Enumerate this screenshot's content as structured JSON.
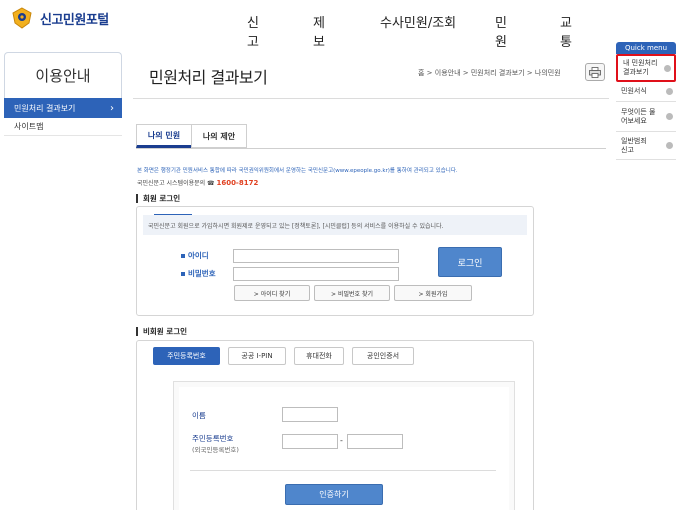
{
  "header": {
    "logo_text": "신고민원포털",
    "nav": [
      "신고",
      "제보",
      "수사민원/조회",
      "민원",
      "교통"
    ]
  },
  "sidebar": {
    "title": "이용안내",
    "items": [
      {
        "label": "민원처리 결과보기",
        "active": true
      },
      {
        "label": "사이트맵",
        "active": false
      }
    ]
  },
  "page": {
    "title": "민원처리 결과보기",
    "breadcrumb": "홈 > 이용안내 > 민원처리 결과보기 > 나의민원"
  },
  "quick_menu": {
    "title": "Quick menu",
    "items": [
      "내 민원처리 결과보기",
      "민원서식",
      "무엇이든 물어보세요",
      "일반범죄 신고"
    ]
  },
  "tabs": [
    "나의 민원",
    "나의 제안"
  ],
  "notice": "본 화면은 행정기관 민원서비스 통합에 따라 국민권익위원회에서 운영하는 국민신문고(www.epeople.go.kr)를 통하여 관리되고 있습니다.",
  "phone_label": "국민신문고 시스템이용문의 ☎",
  "phone_number": "1600-8172",
  "member": {
    "heading": "회원 로그인",
    "message": "국민신문고 회원으로 가입하시면 회원제로 운영되고 있는 [정책토론], [시민클럽] 등의 서비스를 이용하실 수 있습니다.",
    "id_label": "아이디",
    "pw_label": "비밀번호",
    "login_button": "로그인",
    "find_id": "> 아이디 찾기",
    "find_pw": "> 비밀번호 찾기",
    "join": "> 회원가입"
  },
  "nonmember": {
    "heading": "비회원 로그인",
    "tabs": [
      "주민등록번호",
      "공공 I-PIN",
      "휴대전화",
      "공인인증서"
    ],
    "name_label": "이름",
    "rrn_label": "주민등록번호",
    "rrn_sub": "(외국인등록번호)",
    "dash": "-",
    "verify_button": "인증하기"
  },
  "colors": {
    "brand": "#2d63b8",
    "highlight": "#e0101a",
    "phone": "#e04020"
  }
}
